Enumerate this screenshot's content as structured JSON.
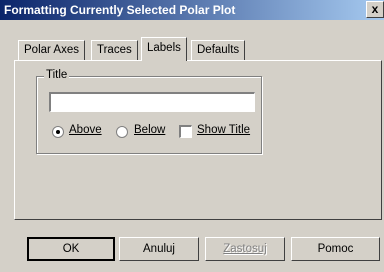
{
  "window": {
    "title": "Formatting Currently Selected Polar Plot",
    "close_label": "x"
  },
  "tabs": [
    {
      "label": "Polar Axes",
      "active": false
    },
    {
      "label": "Traces",
      "active": false
    },
    {
      "label": "Labels",
      "active": true
    },
    {
      "label": "Defaults",
      "active": false
    }
  ],
  "labels_tab": {
    "group_title": "Title",
    "title_value": "",
    "position_options": [
      {
        "label": "Above",
        "selected": true
      },
      {
        "label": "Below",
        "selected": false
      }
    ],
    "show_title": {
      "label": "Show Title",
      "checked": false
    }
  },
  "buttons": {
    "ok": "OK",
    "cancel": "Anuluj",
    "apply": "Zastosuj",
    "help": "Pomoc"
  }
}
